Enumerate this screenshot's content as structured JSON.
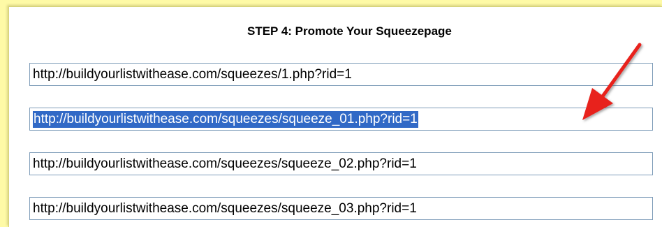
{
  "step_title": "STEP 4: Promote Your Squeezepage",
  "urls": [
    "http://buildyourlistwithease.com/squeezes/1.php?rid=1",
    "http://buildyourlistwithease.com/squeezes/squeeze_01.php?rid=1",
    "http://buildyourlistwithease.com/squeezes/squeeze_02.php?rid=1",
    "http://buildyourlistwithease.com/squeezes/squeeze_03.php?rid=1"
  ],
  "selected_index": 1,
  "annotation": {
    "icon": "red-arrow-icon",
    "color": "#e8231f"
  },
  "colors": {
    "background": "#fefaa6",
    "selection": "#3169c6",
    "field_border": "#7f9db9"
  }
}
